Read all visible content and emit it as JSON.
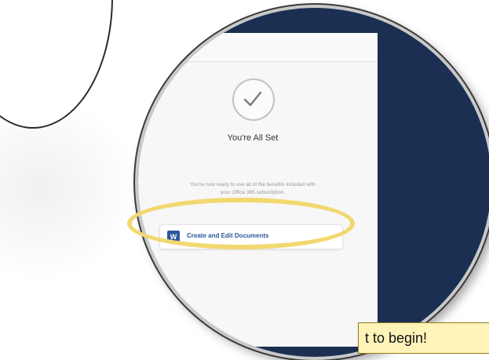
{
  "screen": {
    "title": "You're All Set",
    "description_line1": "You're now ready to use all of the benefits included with",
    "description_line2": "your Office 365 subscription.",
    "cta_label": "Create and Edit Documents"
  },
  "callout": {
    "text": "t to begin!"
  },
  "colors": {
    "navy": "#1b2f52",
    "highlight": "#f2d870",
    "word_blue": "#2b579a",
    "callout_bg": "#fff3b8"
  },
  "icons": {
    "check": "checkmark-icon",
    "word": "word-app-icon"
  }
}
